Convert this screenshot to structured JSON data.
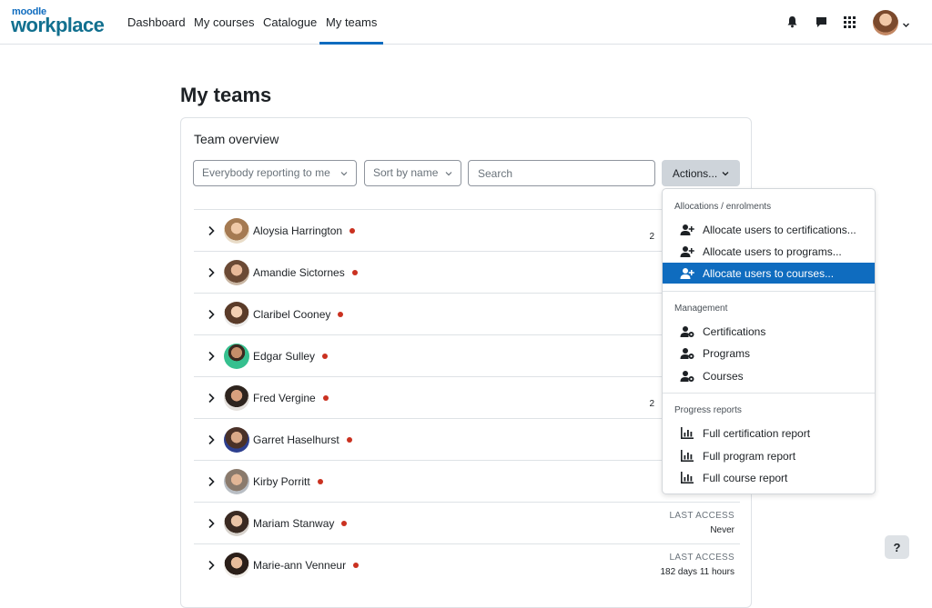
{
  "brand": {
    "line1": "moodle",
    "line2": "workplace"
  },
  "nav": {
    "items": [
      {
        "label": "Dashboard"
      },
      {
        "label": "My courses"
      },
      {
        "label": "Catalogue"
      },
      {
        "label": "My teams"
      }
    ],
    "active": "My teams"
  },
  "page": {
    "title": "My teams"
  },
  "card": {
    "title": "Team overview",
    "filter_reporting": "Everybody reporting to me",
    "sort": "Sort by name",
    "search_placeholder": "Search",
    "actions_label": "Actions..."
  },
  "members": [
    {
      "name": "Aloysia Harrington",
      "partial": "2"
    },
    {
      "name": "Amandie Sictornes"
    },
    {
      "name": "Claribel Cooney"
    },
    {
      "name": "Edgar Sulley"
    },
    {
      "name": "Fred Vergine",
      "partial": "2"
    },
    {
      "name": "Garret Haselhurst"
    },
    {
      "name": "Kirby Porritt"
    },
    {
      "name": "Mariam Stanway",
      "last_access_label": "LAST ACCESS",
      "last_access": "Never"
    },
    {
      "name": "Marie-ann Venneur",
      "last_access_label": "LAST ACCESS",
      "last_access": "182 days 11 hours"
    }
  ],
  "actions_menu": {
    "allocations": {
      "header": "Allocations / enrolments",
      "items": [
        "Allocate users to certifications...",
        "Allocate users to programs...",
        "Allocate users to courses..."
      ],
      "active_index": 2
    },
    "management": {
      "header": "Management",
      "items": [
        "Certifications",
        "Programs",
        "Courses"
      ]
    },
    "progress": {
      "header": "Progress reports",
      "items": [
        "Full certification report",
        "Full program report",
        "Full course report"
      ]
    }
  },
  "colors": {
    "primary": "#0f6cbf",
    "status_dot": "#ca3120"
  },
  "help_label": "?"
}
